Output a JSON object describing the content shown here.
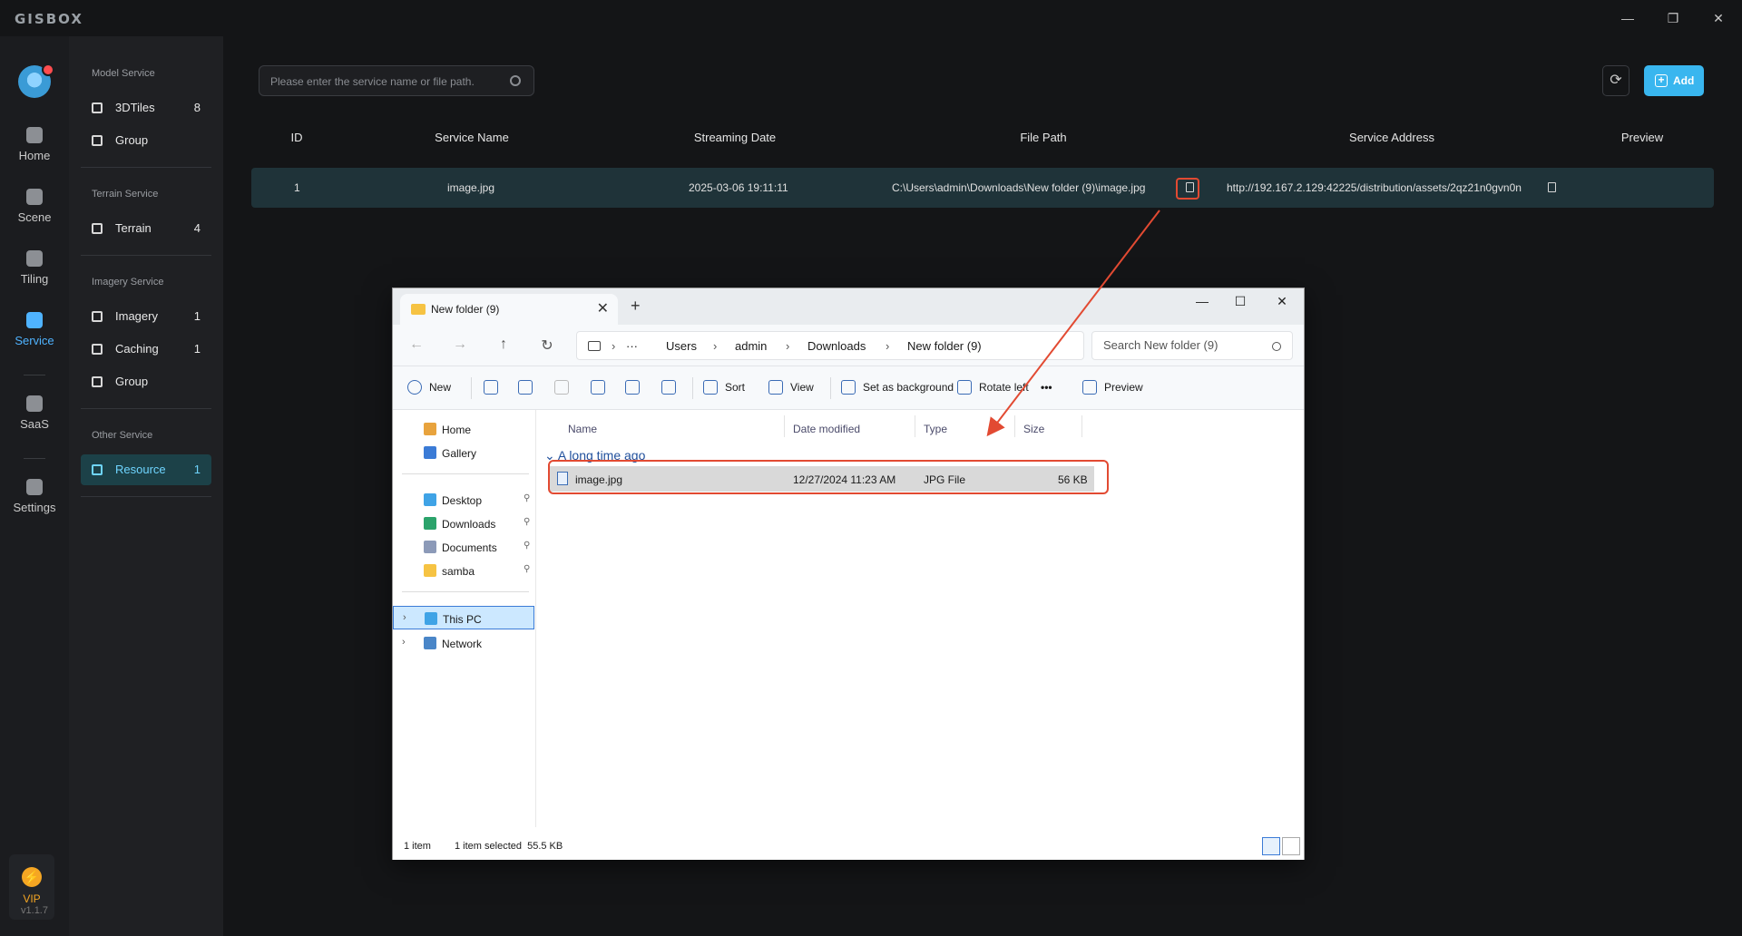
{
  "app": {
    "logo": "GISBOX",
    "version": "v1.1.7"
  },
  "window_controls": {
    "minimize": "—",
    "restore": "❐",
    "close": "✕"
  },
  "rail": {
    "items": [
      {
        "label": "Home"
      },
      {
        "label": "Scene"
      },
      {
        "label": "Tiling"
      },
      {
        "label": "Service"
      },
      {
        "label": "SaaS"
      },
      {
        "label": "Settings"
      }
    ],
    "vip": "VIP"
  },
  "sidebar": {
    "sections": [
      {
        "title": "Model Service",
        "items": [
          {
            "label": "3DTiles",
            "count": "8"
          },
          {
            "label": "Group",
            "count": ""
          }
        ]
      },
      {
        "title": "Terrain Service",
        "items": [
          {
            "label": "Terrain",
            "count": "4"
          }
        ]
      },
      {
        "title": "Imagery Service",
        "items": [
          {
            "label": "Imagery",
            "count": "1"
          },
          {
            "label": "Caching",
            "count": "1"
          },
          {
            "label": "Group",
            "count": ""
          }
        ]
      },
      {
        "title": "Other Service",
        "items": [
          {
            "label": "Resource",
            "count": "1"
          }
        ]
      }
    ]
  },
  "toolbar": {
    "search_placeholder": "Please enter the service name or file path.",
    "refresh_icon": "⟳",
    "add_label": "Add"
  },
  "table": {
    "headers": [
      "ID",
      "Service Name",
      "Streaming Date",
      "File Path",
      "Service Address",
      "Preview"
    ],
    "row": {
      "id": "1",
      "name": "image.jpg",
      "date": "2025-03-06 19:11:11",
      "path": "C:\\Users\\admin\\Downloads\\New folder (9)\\image.jpg",
      "address": "http://192.167.2.129:42225/distribution/assets/2qz21n0gvn0n"
    }
  },
  "explorer": {
    "tab_title": "New folder (9)",
    "tab_close": "✕",
    "new_tab": "+",
    "win": {
      "minimize": "—",
      "maximize": "☐",
      "close": "✕"
    },
    "nav": {
      "back": "←",
      "forward": "→",
      "up": "↑",
      "refresh": "↻",
      "more": "···",
      "chevron": "›"
    },
    "breadcrumb": [
      "Users",
      "admin",
      "Downloads",
      "New folder (9)"
    ],
    "search_placeholder": "Search New folder (9)",
    "commands": {
      "new": "New",
      "sort": "Sort",
      "view": "View",
      "set_bg": "Set as background",
      "rotate": "Rotate left",
      "more": "•••",
      "preview": "Preview"
    },
    "nav_pane": {
      "top": [
        "Home",
        "Gallery"
      ],
      "pinned": [
        "Desktop",
        "Downloads",
        "Documents",
        "samba"
      ],
      "bottom": [
        "This PC",
        "Network"
      ]
    },
    "columns": [
      "Name",
      "Date modified",
      "Type",
      "Size"
    ],
    "group": "A long time ago",
    "file": {
      "name": "image.jpg",
      "modified": "12/27/2024 11:23 AM",
      "type": "JPG File",
      "size": "56 KB"
    },
    "status": {
      "count": "1 item",
      "selected": "1 item selected  55.5 KB"
    }
  },
  "colors": {
    "accent": "#39b6ef",
    "highlight": "#e24a32",
    "row_bg": "#1f3339"
  }
}
